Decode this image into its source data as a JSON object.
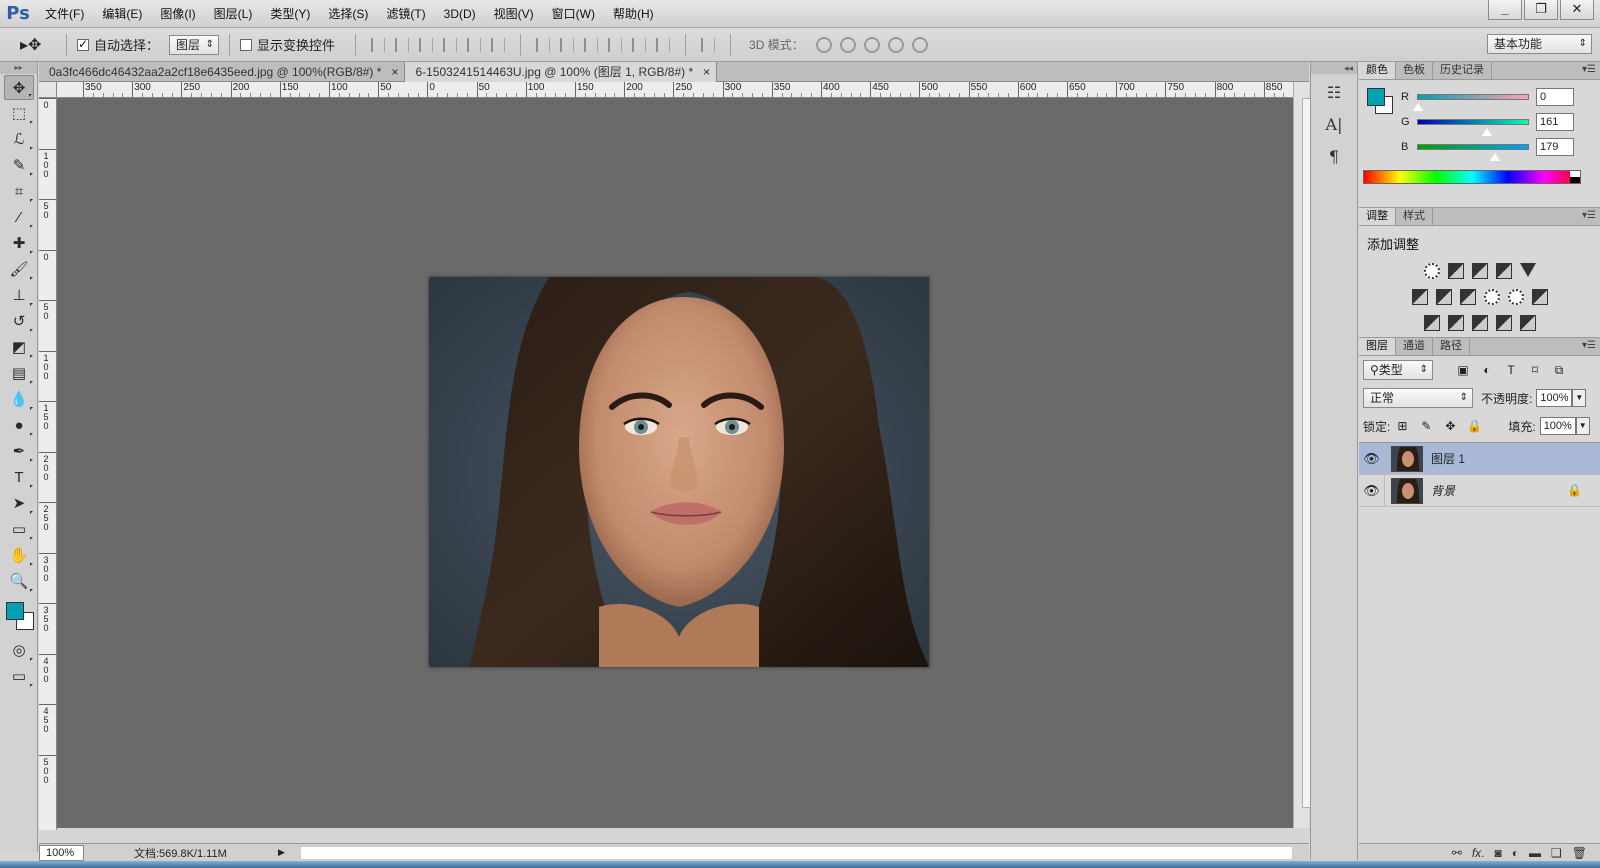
{
  "app": {
    "logo": "Ps"
  },
  "menu": [
    "文件(F)",
    "编辑(E)",
    "图像(I)",
    "图层(L)",
    "类型(Y)",
    "选择(S)",
    "滤镜(T)",
    "3D(D)",
    "视图(V)",
    "窗口(W)",
    "帮助(H)"
  ],
  "window_controls": {
    "minimize": "_",
    "restore": "❐",
    "close": "✕"
  },
  "options": {
    "auto_select_label": "自动选择：",
    "auto_select_checked": true,
    "auto_select_target": "图层",
    "show_transform_label": "显示变换控件",
    "show_transform_checked": false,
    "mode_3d_label": "3D 模式：",
    "workspace": "基本功能"
  },
  "tabs": [
    {
      "title": "0a3fc466dc46432aa2a2cf18e6435eed.jpg @ 100%(RGB/8#) *",
      "close": "×",
      "active": false
    },
    {
      "title": "6-1503241514463U.jpg @ 100% (图层 1, RGB/8#) *",
      "close": "×",
      "active": true
    }
  ],
  "ruler_h": [
    "350",
    "300",
    "250",
    "200",
    "150",
    "100",
    "50",
    "0",
    "50",
    "100",
    "150",
    "200",
    "250",
    "300",
    "350",
    "400",
    "450",
    "500",
    "550",
    "600",
    "650",
    "700",
    "750",
    "800",
    "850"
  ],
  "ruler_v": [
    "0",
    "1 0 0",
    "5 0",
    "0",
    "5 0",
    "1 0 0",
    "1 5 0",
    "2 0 0",
    "2 5 0",
    "3 0 0",
    "3 5 0",
    "4 0 0",
    "4 5 0",
    "5 0 0"
  ],
  "status": {
    "zoom": "100%",
    "doc_info": "文档:569.8K/1.11M"
  },
  "color_panel": {
    "tabs": [
      "颜色",
      "色板",
      "历史记录"
    ],
    "foreground": "#00a1b3",
    "background": "#ffffff",
    "channels": [
      {
        "label": "R",
        "value": "0",
        "gradient": "linear-gradient(to right,#00a1b3,#ffa1b3)",
        "pos": 0
      },
      {
        "label": "G",
        "value": "161",
        "gradient": "linear-gradient(to right,#0000b3,#00ffb3)",
        "pos": 0.63
      },
      {
        "label": "B",
        "value": "179",
        "gradient": "linear-gradient(to right,#00a100,#00a1ff)",
        "pos": 0.7
      }
    ]
  },
  "adjustments_panel": {
    "tabs": [
      "调整",
      "样式"
    ],
    "title": "添加调整"
  },
  "layers_panel": {
    "tabs": [
      "图层",
      "通道",
      "路径"
    ],
    "filter_kind": "类型",
    "blend_mode": "正常",
    "opacity_label": "不透明度:",
    "opacity": "100%",
    "lock_label": "锁定:",
    "fill_label": "填充:",
    "fill": "100%",
    "layers": [
      {
        "name": "图层 1",
        "selected": true,
        "locked": false
      },
      {
        "name": "背景",
        "selected": false,
        "locked": true
      }
    ],
    "footer_icons": [
      "link-icon",
      "fx-icon",
      "mask-icon",
      "adjustment-icon",
      "folder-icon",
      "new-layer-icon",
      "trash-icon"
    ]
  }
}
